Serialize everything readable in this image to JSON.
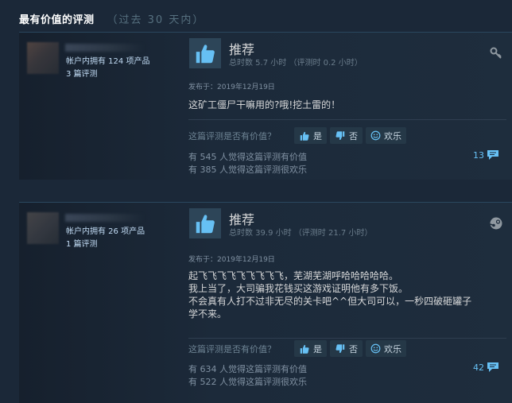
{
  "header": {
    "title": "最有价值的评测",
    "subtitle": "（过去 30 天内）"
  },
  "reviews": [
    {
      "products_owned": "帐户内拥有 124 项产品",
      "review_count": "3 篇评测",
      "verdict": "推荐",
      "hours": "总时数 5.7 小时 （评测时 0.2 小时）",
      "posted": "发布于：2019年12月19日",
      "content": [
        "这矿工僵尸干嘛用的?哦!挖土雷的！"
      ],
      "helpful_question": "这篇评测是否有价值？",
      "vote_yes": "是",
      "vote_no": "否",
      "vote_funny": "欢乐",
      "helpful_stat": "有 545 人觉得这篇评测有价值",
      "funny_stat": "有 385 人觉得这篇评测很欢乐",
      "comment_count": "13",
      "corner_icon": "key-icon"
    },
    {
      "products_owned": "帐户内拥有 26 项产品",
      "review_count": "1 篇评测",
      "verdict": "推荐",
      "hours": "总时数 39.9 小时 （评测时 21.7 小时）",
      "posted": "发布于：2019年12月19日",
      "content": [
        "起飞飞飞飞飞飞飞飞飞，芜湖芜湖呼哈哈哈哈哈。",
        "我上当了，大司骗我花钱买这游戏证明他有多下饭。",
        "不会真有人打不过非无尽的关卡吧^^但大司可以，一秒四破砸罐子",
        "学不来。"
      ],
      "helpful_question": "这篇评测是否有价值？",
      "vote_yes": "是",
      "vote_no": "否",
      "vote_funny": "欢乐",
      "helpful_stat": "有 634 人觉得这篇评测有价值",
      "funny_stat": "有 522 人觉得这篇评测很欢乐",
      "comment_count": "42",
      "corner_icon": "steam-icon"
    }
  ],
  "colors": {
    "background": "#1b2838",
    "accent": "#67c1f5",
    "thumb": "#66c0f4"
  }
}
